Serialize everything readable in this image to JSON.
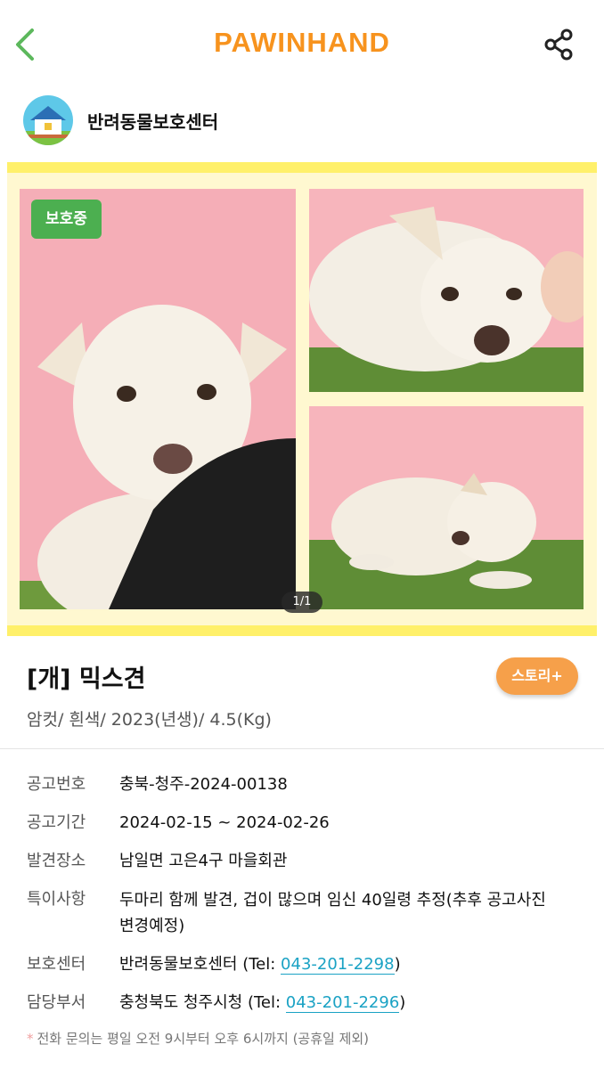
{
  "header": {
    "brand": "PAWINHAND",
    "back_icon": "chevron-left-icon",
    "share_icon": "share-icon"
  },
  "shelter": {
    "name": "반려동물보호센터",
    "avatar_icon": "house-icon"
  },
  "gallery": {
    "status_badge": "보호중",
    "counter": "1/1"
  },
  "animal": {
    "title": "[개] 믹스견",
    "story_button": "스토리+",
    "summary": "암컷/ 흰색/ 2023(년생)/ 4.5(Kg)"
  },
  "info": {
    "notice_no": {
      "label": "공고번호",
      "value": "충북-청주-2024-00138"
    },
    "period": {
      "label": "공고기간",
      "value": "2024-02-15 ~ 2024-02-26"
    },
    "found_place": {
      "label": "발견장소",
      "value": "남일면 고은4구 마을회관"
    },
    "special": {
      "label": "특이사항",
      "value": "두마리 함께 발견, 겁이 많으며 임신 40일령 추정(추후 공고사진 변경예정)"
    },
    "shelter": {
      "label": "보호센터",
      "name": "반려동물보호센터",
      "tel_prefix": "(Tel: ",
      "tel": "043-201-2298",
      "tel_suffix": ")"
    },
    "department": {
      "label": "담당부서",
      "name": "충청북도 청주시청",
      "tel_prefix": "(Tel: ",
      "tel": "043-201-2296",
      "tel_suffix": ")"
    }
  },
  "footer_note": "전화 문의는 평일 오전 9시부터 오후 6시까지 (공휴일 제외)",
  "colors": {
    "brand": "#f7931e",
    "badge": "#4caf50",
    "story": "#f6a04a",
    "link": "#1aa2c4",
    "frame": "#fff06a"
  }
}
